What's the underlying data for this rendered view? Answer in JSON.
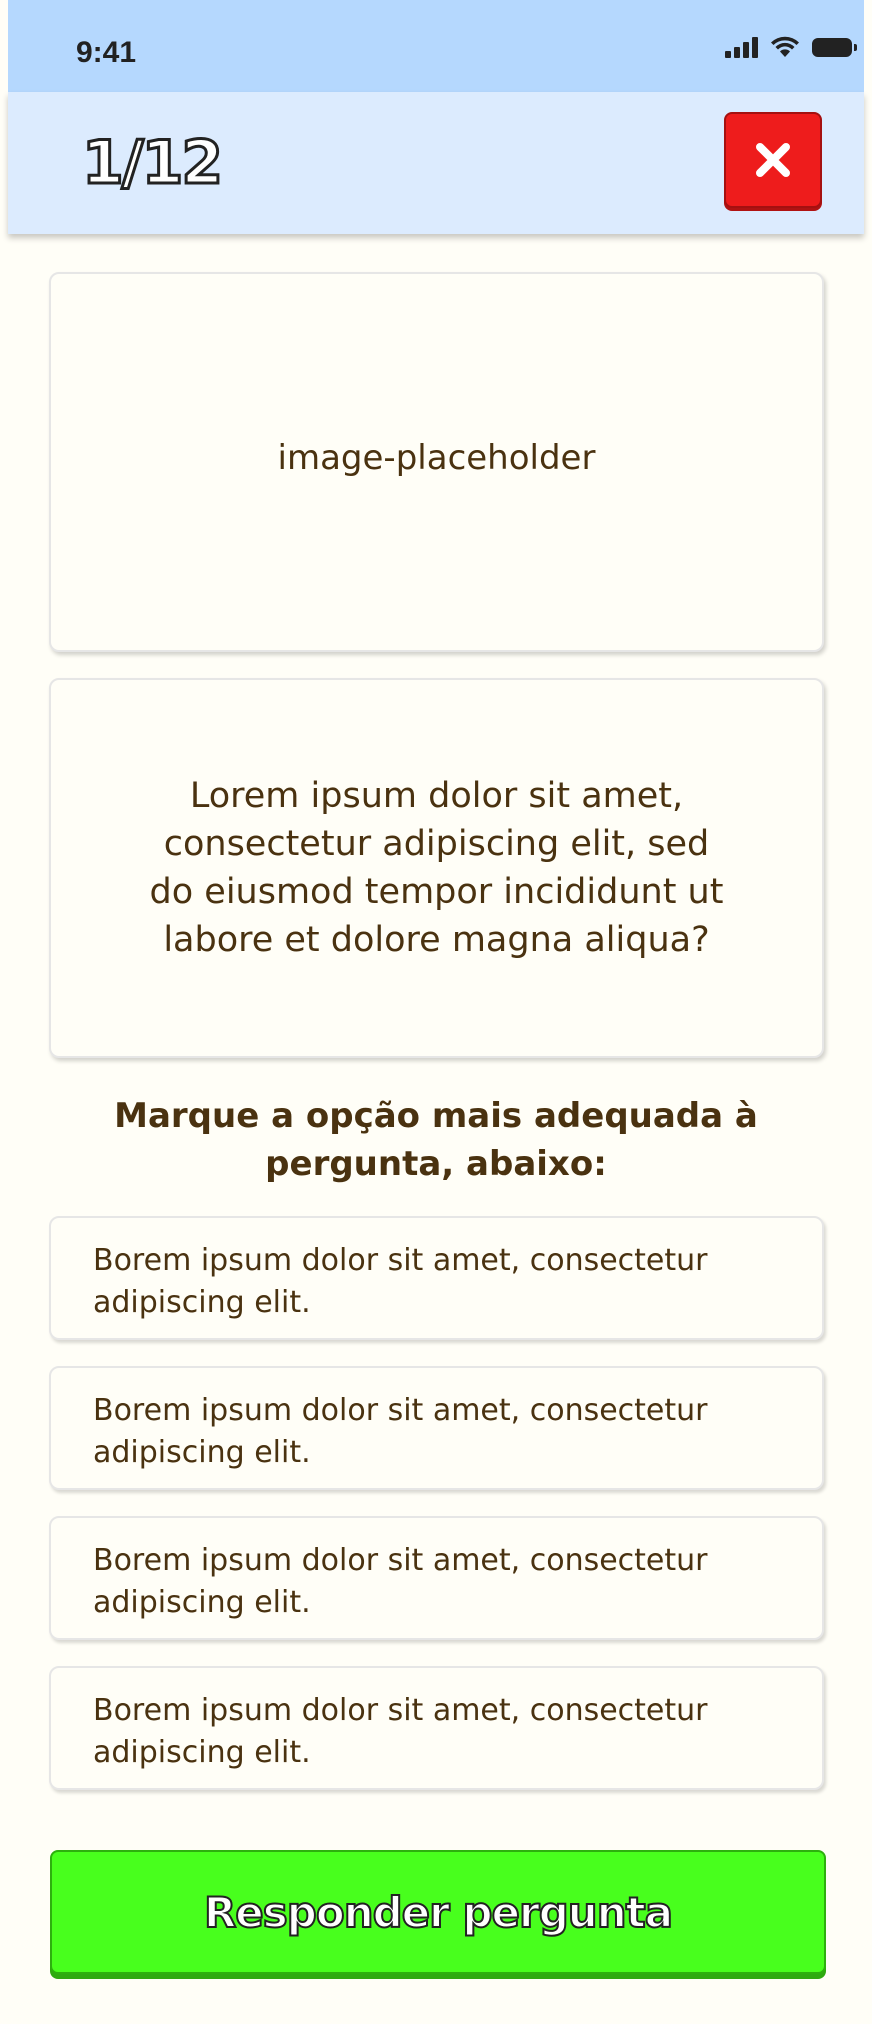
{
  "status_bar": {
    "time": "9:41",
    "icons": [
      "cellular-signal-icon",
      "wifi-icon",
      "battery-icon"
    ]
  },
  "header": {
    "progress": "1/12",
    "close_icon": "close-icon",
    "close_color": "#EE1C1C",
    "background_color": "#DCEBFE"
  },
  "media": {
    "placeholder": "image-placeholder"
  },
  "question": {
    "text": "Lorem ipsum dolor sit amet, consectetur adipiscing elit, sed do eiusmod tempor incididunt ut labore et dolore magna aliqua?"
  },
  "instruction": "Marque a opção mais adequada à pergunta, abaixo:",
  "options": [
    {
      "label": "Borem ipsum dolor sit amet, consectetur adipiscing elit."
    },
    {
      "label": "Borem ipsum dolor sit amet, consectetur adipiscing elit."
    },
    {
      "label": "Borem ipsum dolor sit amet, consectetur adipiscing elit."
    },
    {
      "label": "Borem ipsum dolor sit amet, consectetur adipiscing elit."
    }
  ],
  "submit": {
    "label": "Responder pergunta",
    "color": "#48FF1D"
  },
  "colors": {
    "page_background": "#FFFEF7",
    "text": "#4A3210",
    "status_bar": "#B5D8FE"
  }
}
